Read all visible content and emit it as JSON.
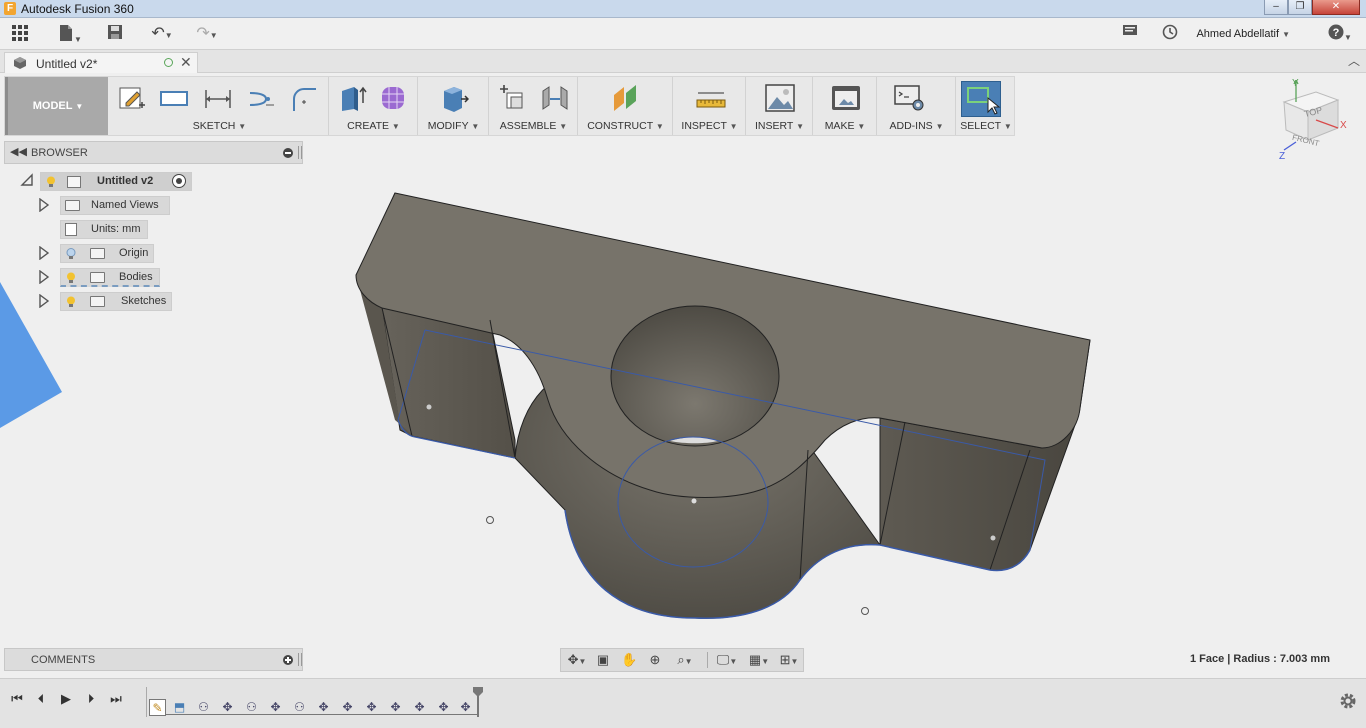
{
  "window": {
    "title": "Autodesk Fusion 360",
    "app_icon": "F"
  },
  "appbar": {
    "user_name": "Ahmed Abdellatif"
  },
  "document_tab": {
    "title": "Untitled v2*"
  },
  "toolbar": {
    "workspace": "MODEL",
    "groups": [
      {
        "label": "SKETCH"
      },
      {
        "label": "CREATE"
      },
      {
        "label": "MODIFY"
      },
      {
        "label": "ASSEMBLE"
      },
      {
        "label": "CONSTRUCT"
      },
      {
        "label": "INSPECT"
      },
      {
        "label": "INSERT"
      },
      {
        "label": "MAKE"
      },
      {
        "label": "ADD-INS"
      },
      {
        "label": "SELECT"
      }
    ]
  },
  "browser": {
    "title": "BROWSER",
    "root": "Untitled v2",
    "items": [
      {
        "label": "Named Views"
      },
      {
        "label": "Units: mm"
      },
      {
        "label": "Origin"
      },
      {
        "label": "Bodies"
      },
      {
        "label": "Sketches"
      }
    ]
  },
  "viewcube": {
    "top": "TOP",
    "front": "FRONT",
    "axis_x": "X",
    "axis_y": "Y",
    "axis_z": "Z"
  },
  "comments": {
    "title": "COMMENTS"
  },
  "status": {
    "selection": "1 Face | Radius : 7.003 mm"
  },
  "colors": {
    "accent": "#5b8fc9",
    "body": "#7d7a70",
    "select_active": "#4a7fb5"
  }
}
